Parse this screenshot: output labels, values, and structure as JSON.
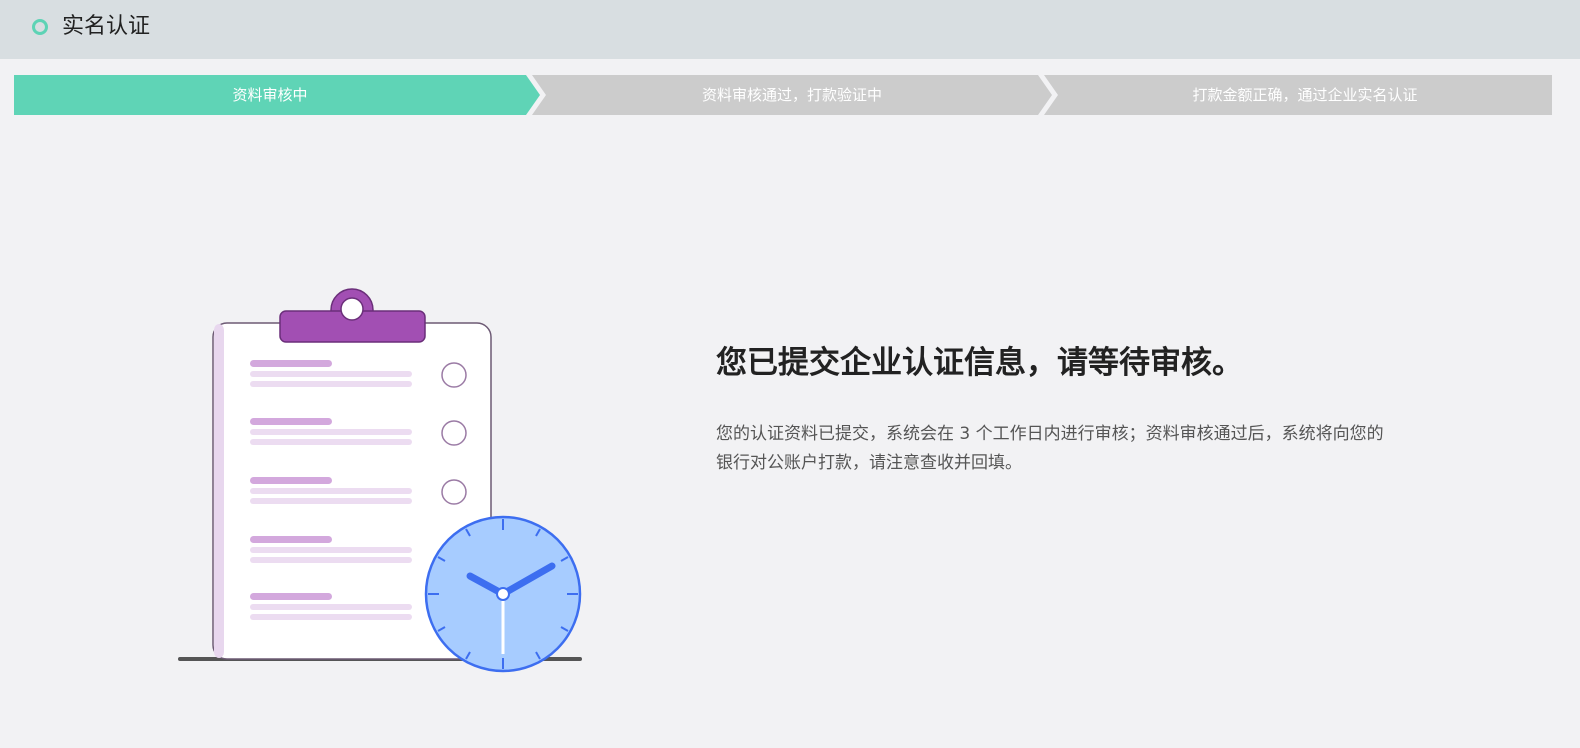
{
  "header": {
    "title": "实名认证"
  },
  "steps": [
    {
      "label": "资料审核中",
      "status": "active"
    },
    {
      "label": "资料审核通过，打款验证中",
      "status": "pending"
    },
    {
      "label": "打款金额正确，通过企业实名认证",
      "status": "pending"
    }
  ],
  "colors": {
    "active_step": "#5fd4b6",
    "pending_step": "#cccccc",
    "header_bg": "#d8dee1",
    "clipboard_accent": "#a24fb3",
    "clock_face": "#a7ccff",
    "clock_hands": "#3d6ef0"
  },
  "illustration": {
    "icon": "clipboard-with-clock-illustration"
  },
  "message": {
    "headline": "您已提交企业认证信息，请等待审核。",
    "description": "您的认证资料已提交，系统会在 3 个工作日内进行审核；资料审核通过后，系统将向您的银行对公账户打款，请注意查收并回填。"
  }
}
